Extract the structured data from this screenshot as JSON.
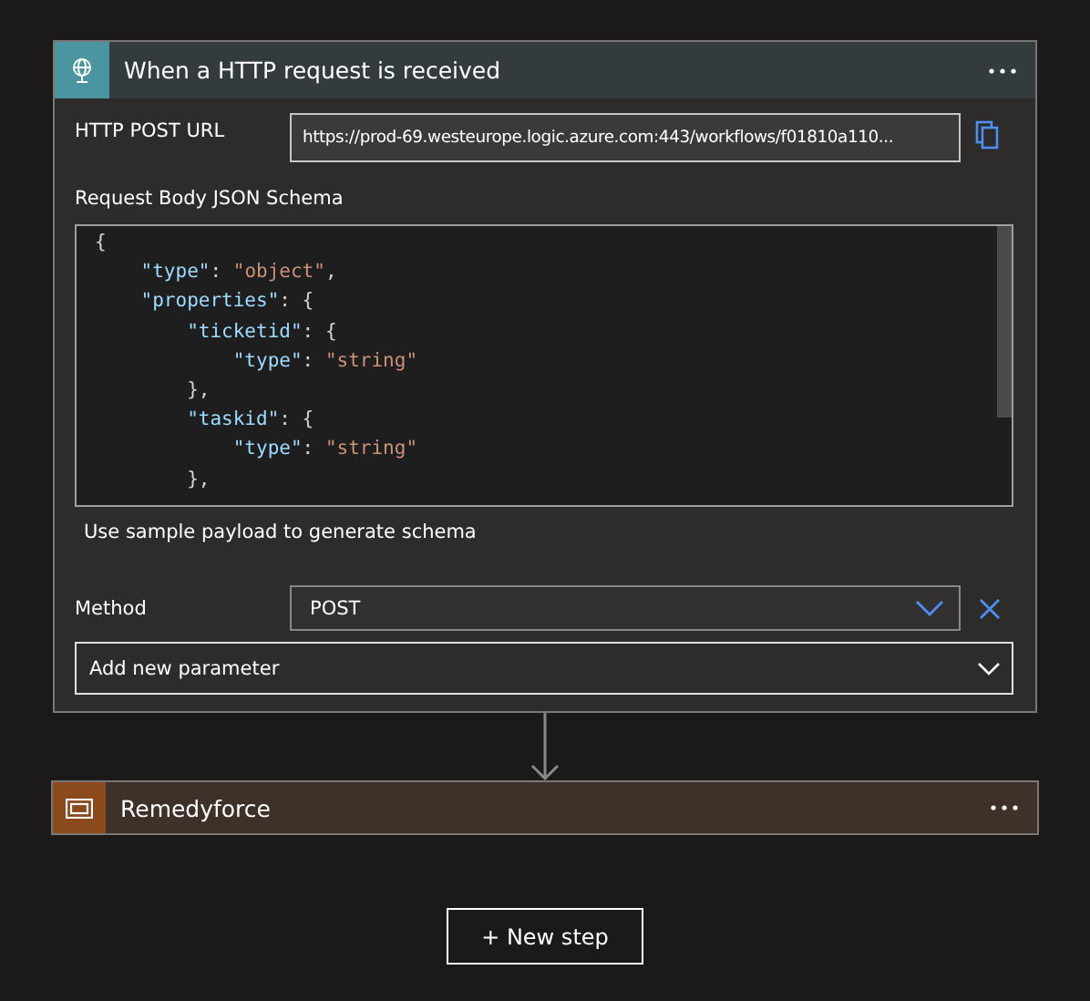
{
  "trigger": {
    "title": "When a HTTP request is received",
    "url_label": "HTTP POST URL",
    "url_value": "https://prod-69.westeurope.logic.azure.com:443/workflows/f01810a110...",
    "schema_label": "Request Body JSON Schema",
    "schema_lines": [
      [
        {
          "kind": "punct",
          "text": "{"
        }
      ],
      [
        {
          "kind": "key",
          "text": "    \"type\""
        },
        {
          "kind": "punct",
          "text": ": "
        },
        {
          "kind": "string",
          "text": "\"object\""
        },
        {
          "kind": "punct",
          "text": ","
        }
      ],
      [
        {
          "kind": "key",
          "text": "    \"properties\""
        },
        {
          "kind": "punct",
          "text": ": {"
        }
      ],
      [
        {
          "kind": "key",
          "text": "        \"ticketid\""
        },
        {
          "kind": "punct",
          "text": ": {"
        }
      ],
      [
        {
          "kind": "key",
          "text": "            \"type\""
        },
        {
          "kind": "punct",
          "text": ": "
        },
        {
          "kind": "string",
          "text": "\"string\""
        }
      ],
      [
        {
          "kind": "punct",
          "text": "        },"
        }
      ],
      [
        {
          "kind": "key",
          "text": "        \"taskid\""
        },
        {
          "kind": "punct",
          "text": ": {"
        }
      ],
      [
        {
          "kind": "key",
          "text": "            \"type\""
        },
        {
          "kind": "punct",
          "text": ": "
        },
        {
          "kind": "string",
          "text": "\"string\""
        }
      ],
      [
        {
          "kind": "punct",
          "text": "        },"
        }
      ]
    ],
    "sample_link": "Use sample payload to generate schema",
    "method_label": "Method",
    "method_value": "POST",
    "add_parameter": "Add new parameter"
  },
  "action": {
    "title": "Remedyforce"
  },
  "new_step": "+ New step"
}
